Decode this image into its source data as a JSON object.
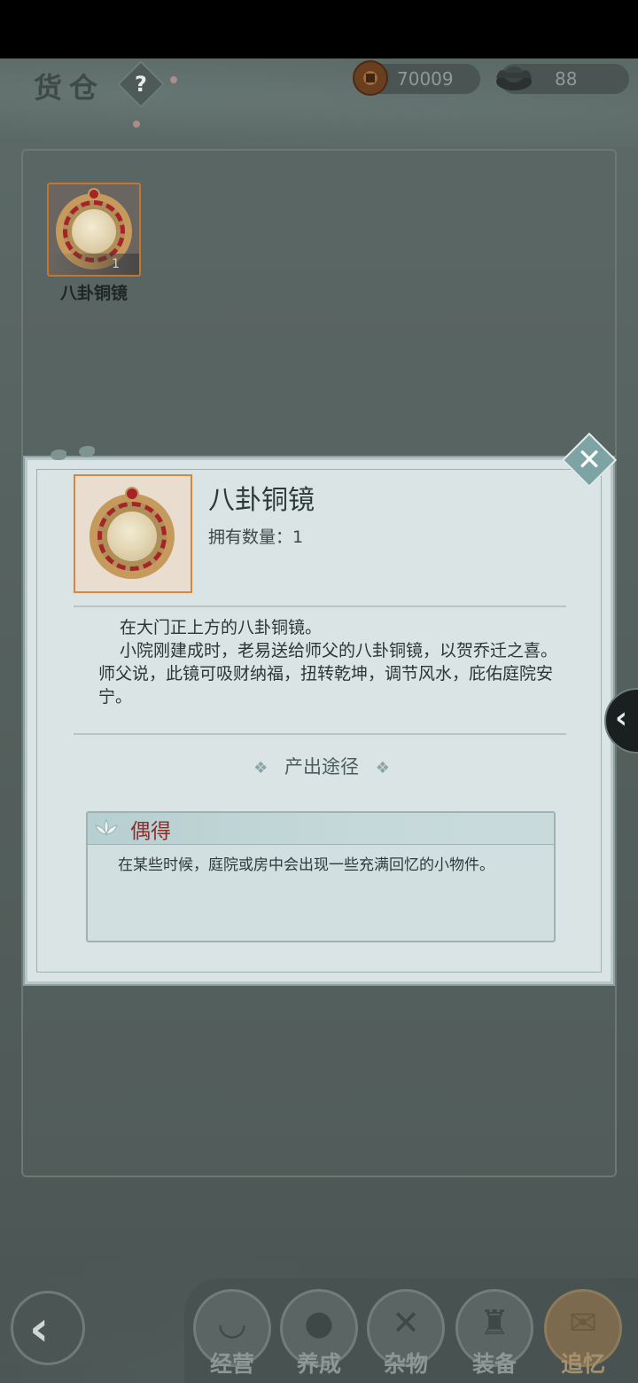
{
  "header": {
    "title": "货仓",
    "help_symbol": "?",
    "currencies": [
      {
        "icon": "copper-coin-icon",
        "value": "70009"
      },
      {
        "icon": "silver-ingot-icon",
        "value": "88"
      }
    ]
  },
  "inventory": {
    "items": [
      {
        "name": "八卦铜镜",
        "count": "1",
        "icon": "bagua-mirror-icon"
      }
    ]
  },
  "dialog": {
    "close_symbol": "✕",
    "item_name": "八卦铜镜",
    "owned_label": "拥有数量：1",
    "description": [
      "在大门正上方的八卦铜镜。",
      "小院刚建成时，老易送给师父的八卦铜镜，以贺乔迁之喜。师父说，此镜可吸财纳福，扭转乾坤，调节风水，庇佑庭院安宁。"
    ],
    "source_heading": "产出途径",
    "sources": [
      {
        "name": "偶得",
        "icon": "lotus-icon",
        "desc": "在某些时候，庭院或房中会出现一些充满回忆的小物件。"
      }
    ]
  },
  "side_tab": {
    "symbol": "‹"
  },
  "bottom_nav": {
    "back_symbol": "‹",
    "items": [
      {
        "label": "经营",
        "icon": "bowl-icon",
        "glyph": "◡"
      },
      {
        "label": "养成",
        "icon": "crystal-ball-icon",
        "glyph": "●"
      },
      {
        "label": "杂物",
        "icon": "bundle-icon",
        "glyph": "✕"
      },
      {
        "label": "装备",
        "icon": "robe-icon",
        "glyph": "♜"
      },
      {
        "label": "追忆",
        "icon": "letter-icon",
        "glyph": "✉"
      }
    ],
    "active_index": 4
  }
}
